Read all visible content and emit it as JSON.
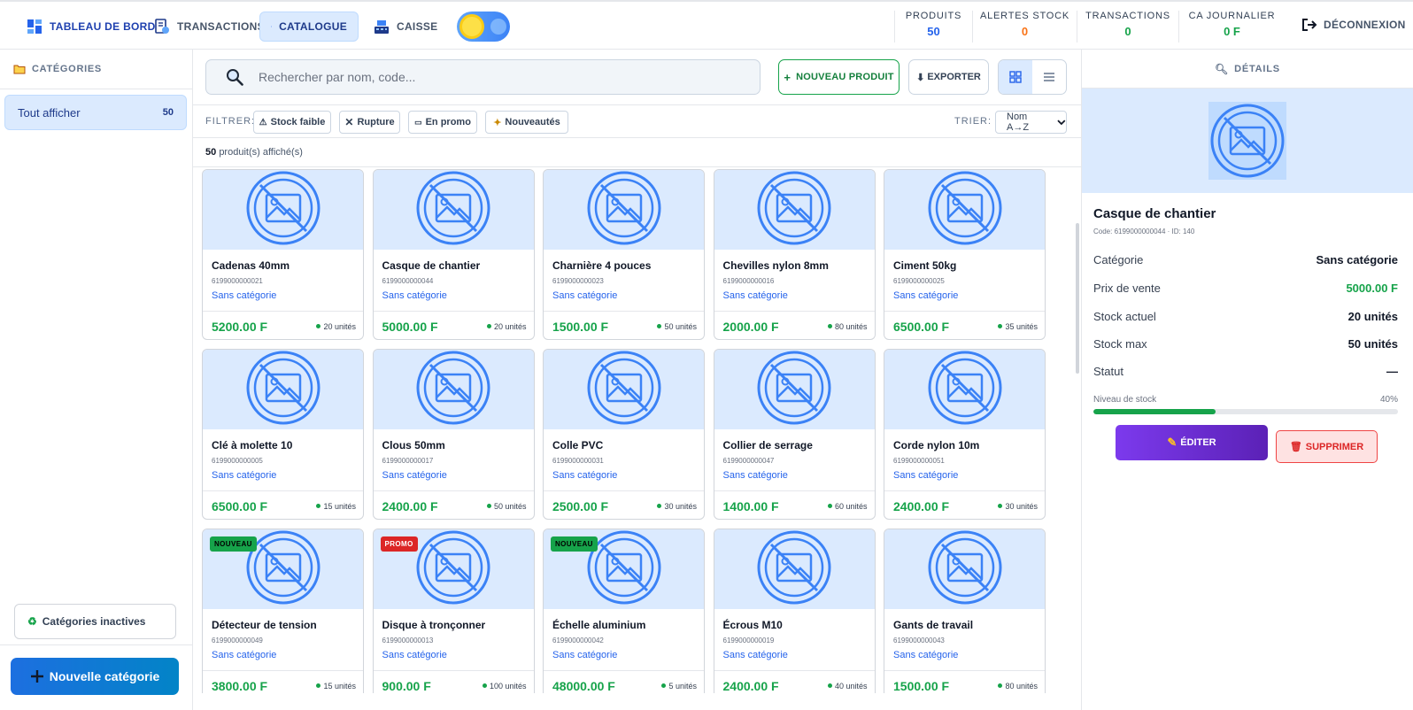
{
  "nav": {
    "dashboard": "TABLEAU DE BORD",
    "transactions": "TRANSACTIONS",
    "catalogue": "CATALOGUE",
    "caisse": "CAISSE"
  },
  "stats": [
    {
      "label": "PRODUITS",
      "value": "50",
      "color": "#2563eb"
    },
    {
      "label": "ALERTES STOCK",
      "value": "0",
      "color": "#f97316"
    },
    {
      "label": "TRANSACTIONS",
      "value": "0",
      "color": "#16a34a"
    },
    {
      "label": "CA JOURNALIER",
      "value": "0 F",
      "color": "#16a34a"
    }
  ],
  "logout": "DÉCONNEXION",
  "sidebar": {
    "title": "CATÉGORIES",
    "items": [
      {
        "label": "Tout afficher",
        "count": "50"
      }
    ],
    "inactive": "Catégories inactives",
    "new_category": "Nouvelle catégorie"
  },
  "toolbar": {
    "search_placeholder": "Rechercher par nom, code...",
    "new_product": "NOUVEAU PRODUIT",
    "export": "EXPORTER"
  },
  "filters": {
    "label": "FILTRER:",
    "chips": [
      "Stock faible",
      "Rupture",
      "En promo",
      "Nouveautés"
    ],
    "sort_label": "TRIER:",
    "sort_value": "Nom A→Z"
  },
  "count": {
    "number": "50",
    "suffix": "produit(s) affiché(s)"
  },
  "products": [
    {
      "name": "Cadenas 40mm",
      "code": "6199000000021",
      "category": "Sans catégorie",
      "price": "5200.00 F",
      "stock": "20 unités",
      "badge": ""
    },
    {
      "name": "Casque de chantier",
      "code": "6199000000044",
      "category": "Sans catégorie",
      "price": "5000.00 F",
      "stock": "20 unités",
      "badge": ""
    },
    {
      "name": "Charnière 4 pouces",
      "code": "6199000000023",
      "category": "Sans catégorie",
      "price": "1500.00 F",
      "stock": "50 unités",
      "badge": ""
    },
    {
      "name": "Chevilles nylon 8mm",
      "code": "6199000000016",
      "category": "Sans catégorie",
      "price": "2000.00 F",
      "stock": "80 unités",
      "badge": ""
    },
    {
      "name": "Ciment 50kg",
      "code": "6199000000025",
      "category": "Sans catégorie",
      "price": "6500.00 F",
      "stock": "35 unités",
      "badge": ""
    },
    {
      "name": "Clé à molette 10",
      "code": "6199000000005",
      "category": "Sans catégorie",
      "price": "6500.00 F",
      "stock": "15 unités",
      "badge": ""
    },
    {
      "name": "Clous 50mm",
      "code": "6199000000017",
      "category": "Sans catégorie",
      "price": "2400.00 F",
      "stock": "50 unités",
      "badge": ""
    },
    {
      "name": "Colle PVC",
      "code": "6199000000031",
      "category": "Sans catégorie",
      "price": "2500.00 F",
      "stock": "30 unités",
      "badge": ""
    },
    {
      "name": "Collier de serrage",
      "code": "6199000000047",
      "category": "Sans catégorie",
      "price": "1400.00 F",
      "stock": "60 unités",
      "badge": ""
    },
    {
      "name": "Corde nylon 10m",
      "code": "6199000000051",
      "category": "Sans catégorie",
      "price": "2400.00 F",
      "stock": "30 unités",
      "badge": ""
    },
    {
      "name": "Détecteur de tension",
      "code": "6199000000049",
      "category": "Sans catégorie",
      "price": "3800.00 F",
      "stock": "15 unités",
      "badge": "NOUVEAU"
    },
    {
      "name": "Disque à tronçonner",
      "code": "6199000000013",
      "category": "Sans catégorie",
      "price": "900.00 F",
      "stock": "100 unités",
      "badge": "PROMO"
    },
    {
      "name": "Échelle aluminium",
      "code": "6199000000042",
      "category": "Sans catégorie",
      "price": "48000.00 F",
      "stock": "5 unités",
      "badge": "NOUVEAU"
    },
    {
      "name": "Écrous M10",
      "code": "6199000000019",
      "category": "Sans catégorie",
      "price": "2400.00 F",
      "stock": "40 unités",
      "badge": ""
    },
    {
      "name": "Gants de travail",
      "code": "6199000000043",
      "category": "Sans catégorie",
      "price": "1500.00 F",
      "stock": "80 unités",
      "badge": ""
    }
  ],
  "details": {
    "title": "DÉTAILS",
    "name": "Casque de chantier",
    "code_line": "Code: 6199000000044 · ID: 140",
    "rows": [
      {
        "key": "Catégorie",
        "value": "Sans catégorie"
      },
      {
        "key": "Prix de vente",
        "value": "5000.00 F"
      },
      {
        "key": "Stock actuel",
        "value": "20 unités"
      },
      {
        "key": "Stock max",
        "value": "50 unités"
      },
      {
        "key": "Statut",
        "value": "—"
      }
    ],
    "level_label": "Niveau de stock",
    "level_text": "40%",
    "level_value": 0.4,
    "edit": "ÉDITER",
    "delete": "SUPPRIMER"
  }
}
